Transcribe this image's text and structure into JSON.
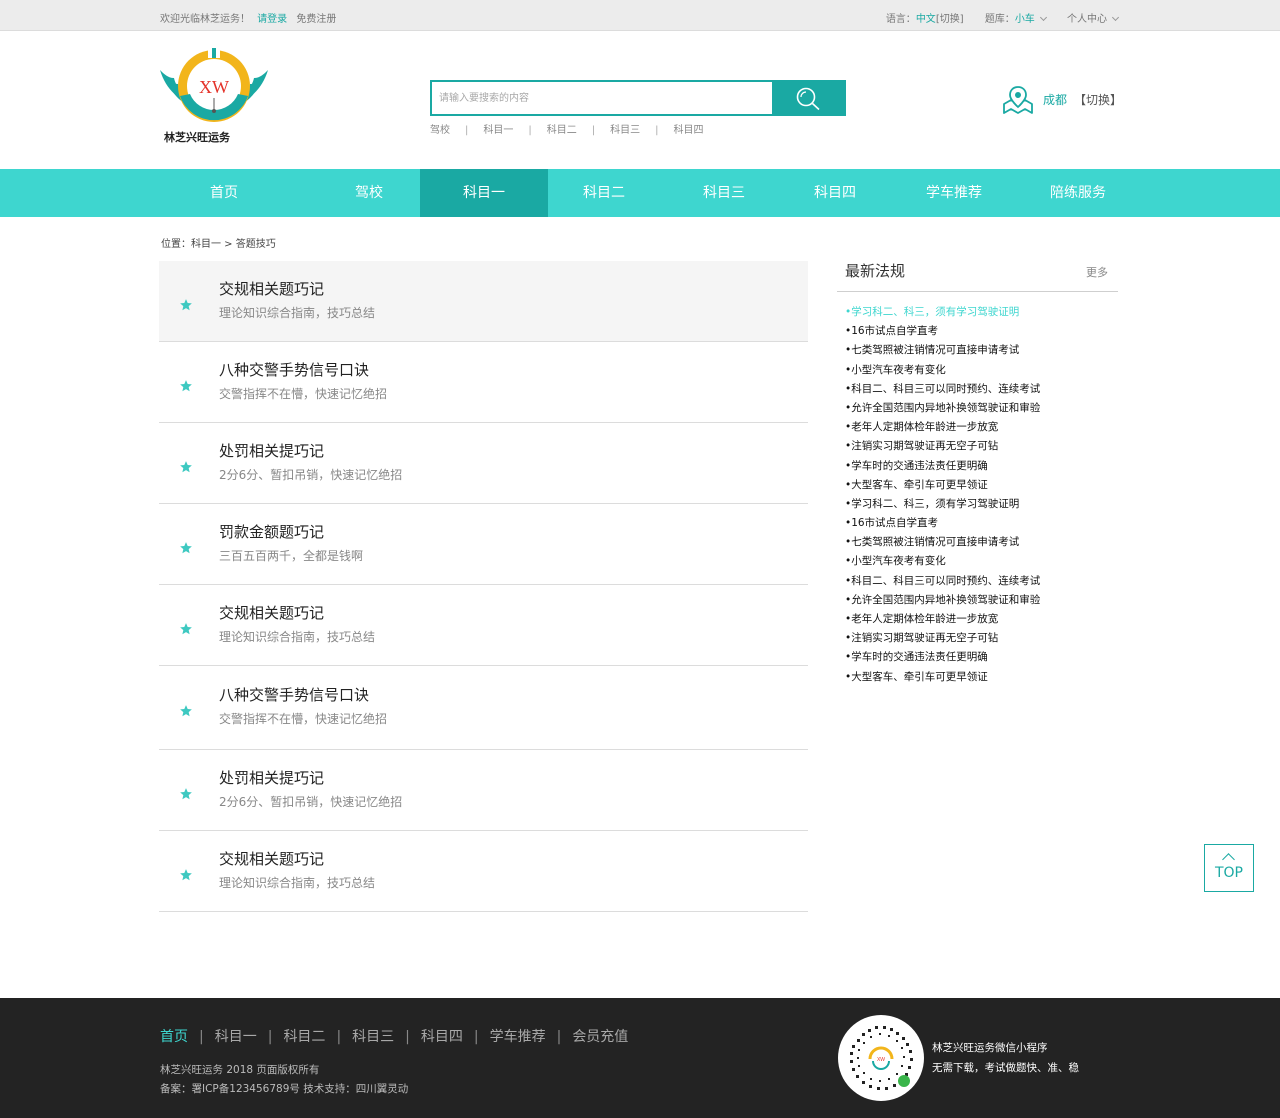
{
  "topbar": {
    "welcome": "欢迎光临林芝运务！",
    "login": "请登录",
    "register": "免费注册",
    "lang_label": "语言：",
    "lang_value": "中文",
    "lang_switch": "[切换]",
    "bank_label": "题库：",
    "bank_value": "小车",
    "user_center": "个人中心"
  },
  "brand": {
    "logo_text": "XW",
    "name": "林芝兴旺运务"
  },
  "search": {
    "placeholder": "请输入要搜索的内容",
    "hot_words": [
      "驾校",
      "科目一",
      "科目二",
      "科目三",
      "科目四"
    ]
  },
  "city": {
    "name": "成都",
    "switch": "【切换】"
  },
  "nav": {
    "items": [
      "首页",
      "驾校",
      "科目一",
      "科目二",
      "科目三",
      "科目四",
      "学车推荐",
      "陪练服务"
    ],
    "active_index": 2
  },
  "breadcrumb": "位置：科目一 > 答题技巧",
  "articles": [
    {
      "title": "交规相关题巧记",
      "subtitle": "理论知识综合指南，技巧总结"
    },
    {
      "title": "八种交警手势信号口诀",
      "subtitle": "交警指挥不在懵，快速记忆绝招"
    },
    {
      "title": "处罚相关提巧记",
      "subtitle": "2分6分、暂扣吊销，快速记忆绝招"
    },
    {
      "title": "罚款金额题巧记",
      "subtitle": "三百五百两千，全都是钱啊"
    },
    {
      "title": "交规相关题巧记",
      "subtitle": "理论知识综合指南，技巧总结"
    },
    {
      "title": "八种交警手势信号口诀",
      "subtitle": "交警指挥不在懵，快速记忆绝招"
    },
    {
      "title": "处罚相关提巧记",
      "subtitle": "2分6分、暂扣吊销，快速记忆绝招"
    },
    {
      "title": "交规相关题巧记",
      "subtitle": "理论知识综合指南，技巧总结"
    }
  ],
  "sidebar": {
    "title": "最新法规",
    "more": "更多",
    "items": [
      "•学习科二、科三，须有学习驾驶证明",
      "•16市试点自学直考",
      "•七类驾照被注销情况可直接申请考试",
      "•小型汽车夜考有变化",
      "•科目二、科目三可以同时预约、连续考试",
      "•允许全国范围内异地补换领驾驶证和审验",
      "•老年人定期体检年龄进一步放宽",
      "•注销实习期驾驶证再无空子可钻",
      "•学车时的交通违法责任更明确",
      "•大型客车、牵引车可更早领证",
      "•学习科二、科三，须有学习驾驶证明",
      "•16市试点自学直考",
      "•七类驾照被注销情况可直接申请考试",
      "•小型汽车夜考有变化",
      "•科目二、科目三可以同时预约、连续考试",
      "•允许全国范围内异地补换领驾驶证和审验",
      "•老年人定期体检年龄进一步放宽",
      "•注销实习期驾驶证再无空子可钻",
      "•学车时的交通违法责任更明确",
      "•大型客车、牵引车可更早领证"
    ]
  },
  "totop": "TOP",
  "footer": {
    "nav": [
      "首页",
      "科目一",
      "科目二",
      "科目三",
      "科目四",
      "学车推荐",
      "会员充值"
    ],
    "copyright": "林芝兴旺运务  2018  页面版权所有",
    "icp": "备案：署ICP备123456789号    技术支持：四川翼灵动",
    "mini_title": "林芝兴旺运务微信小程序",
    "mini_desc": "无需下载，考试做题快、准、稳"
  },
  "colors": {
    "accent": "#1aa9a3",
    "nav_bg": "#3ed6cf",
    "footer_bg": "#232323",
    "logo_yellow": "#f2b51b",
    "logo_red": "#e4332a"
  }
}
